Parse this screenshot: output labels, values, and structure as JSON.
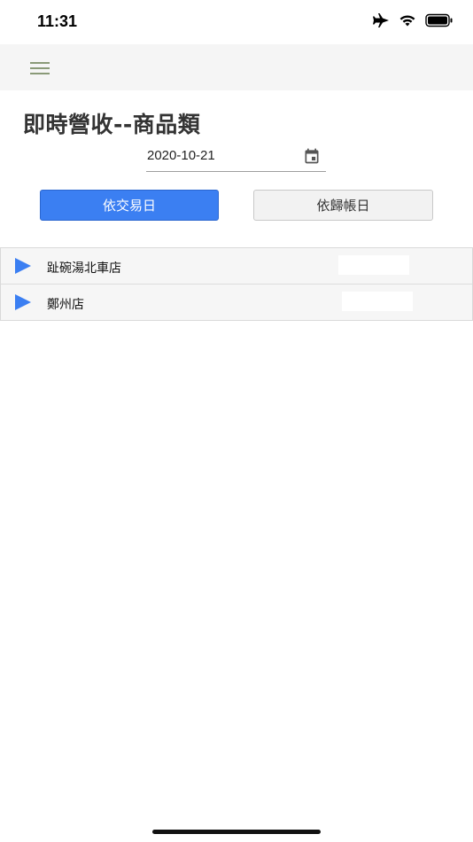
{
  "status_bar": {
    "time": "11:31"
  },
  "header": {
    "menu_icon": "hamburger-icon"
  },
  "page": {
    "title": "即時營收--商品類"
  },
  "filter": {
    "date": "2020-10-21",
    "calendar_icon": "calendar-icon"
  },
  "buttons": {
    "by_transaction_date": "依交易日",
    "by_posting_date": "依歸帳日"
  },
  "stores": [
    {
      "name": "趾碗湯北車店"
    },
    {
      "name": "鄭州店"
    }
  ],
  "colors": {
    "accent": "#3b7ff2",
    "navbar_bg": "#f5f5f5",
    "list_bg": "#f6f6f6"
  }
}
